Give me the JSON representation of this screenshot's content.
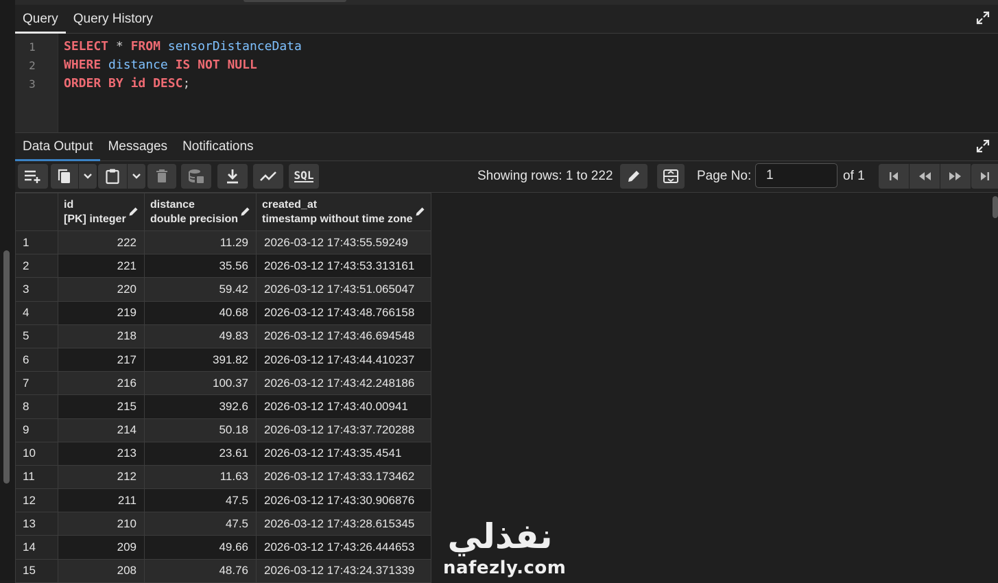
{
  "query_tabs": [
    {
      "label": "Query",
      "active": true
    },
    {
      "label": "Query History",
      "active": false
    }
  ],
  "editor": {
    "line_numbers": [
      "1",
      "2",
      "3"
    ],
    "lines": [
      [
        {
          "t": "SELECT",
          "c": "kw"
        },
        {
          "t": " "
        },
        {
          "t": "*",
          "c": "op"
        },
        {
          "t": " "
        },
        {
          "t": "FROM",
          "c": "kw"
        },
        {
          "t": " "
        },
        {
          "t": "sensorDistanceData",
          "c": "id"
        }
      ],
      [
        {
          "t": "WHERE",
          "c": "kw"
        },
        {
          "t": " "
        },
        {
          "t": "distance",
          "c": "id"
        },
        {
          "t": " "
        },
        {
          "t": "IS",
          "c": "kw"
        },
        {
          "t": " "
        },
        {
          "t": "NOT",
          "c": "kw"
        },
        {
          "t": " "
        },
        {
          "t": "NULL",
          "c": "kw"
        }
      ],
      [
        {
          "t": "ORDER",
          "c": "kw"
        },
        {
          "t": " "
        },
        {
          "t": "BY",
          "c": "kw"
        },
        {
          "t": " "
        },
        {
          "t": "id",
          "c": "kw"
        },
        {
          "t": " "
        },
        {
          "t": "DESC",
          "c": "kw"
        },
        {
          "t": ";",
          "c": "op"
        }
      ]
    ]
  },
  "result_tabs": [
    {
      "label": "Data Output",
      "active": true
    },
    {
      "label": "Messages",
      "active": false
    },
    {
      "label": "Notifications",
      "active": false
    }
  ],
  "toolbar": {
    "showing_rows": "Showing rows: 1 to 222",
    "page_no_label": "Page No:",
    "page_no_value": "1",
    "of_label": "of 1",
    "sql_label": "SQL"
  },
  "grid": {
    "columns": [
      {
        "name": "id",
        "type": "[PK] integer"
      },
      {
        "name": "distance",
        "type": "double precision"
      },
      {
        "name": "created_at",
        "type": "timestamp without time zone"
      }
    ],
    "rows": [
      [
        "1",
        "222",
        "11.29",
        "2026-03-12 17:43:55.59249"
      ],
      [
        "2",
        "221",
        "35.56",
        "2026-03-12 17:43:53.313161"
      ],
      [
        "3",
        "220",
        "59.42",
        "2026-03-12 17:43:51.065047"
      ],
      [
        "4",
        "219",
        "40.68",
        "2026-03-12 17:43:48.766158"
      ],
      [
        "5",
        "218",
        "49.83",
        "2026-03-12 17:43:46.694548"
      ],
      [
        "6",
        "217",
        "391.82",
        "2026-03-12 17:43:44.410237"
      ],
      [
        "7",
        "216",
        "100.37",
        "2026-03-12 17:43:42.248186"
      ],
      [
        "8",
        "215",
        "392.6",
        "2026-03-12 17:43:40.00941"
      ],
      [
        "9",
        "214",
        "50.18",
        "2026-03-12 17:43:37.720288"
      ],
      [
        "10",
        "213",
        "23.61",
        "2026-03-12 17:43:35.4541"
      ],
      [
        "11",
        "212",
        "11.63",
        "2026-03-12 17:43:33.173462"
      ],
      [
        "12",
        "211",
        "47.5",
        "2026-03-12 17:43:30.906876"
      ],
      [
        "13",
        "210",
        "47.5",
        "2026-03-12 17:43:28.615345"
      ],
      [
        "14",
        "209",
        "49.66",
        "2026-03-12 17:43:26.444653"
      ],
      [
        "15",
        "208",
        "48.76",
        "2026-03-12 17:43:24.371339"
      ]
    ]
  },
  "watermark": {
    "arabic": "نفذلي",
    "latin": "nafezly.com"
  }
}
